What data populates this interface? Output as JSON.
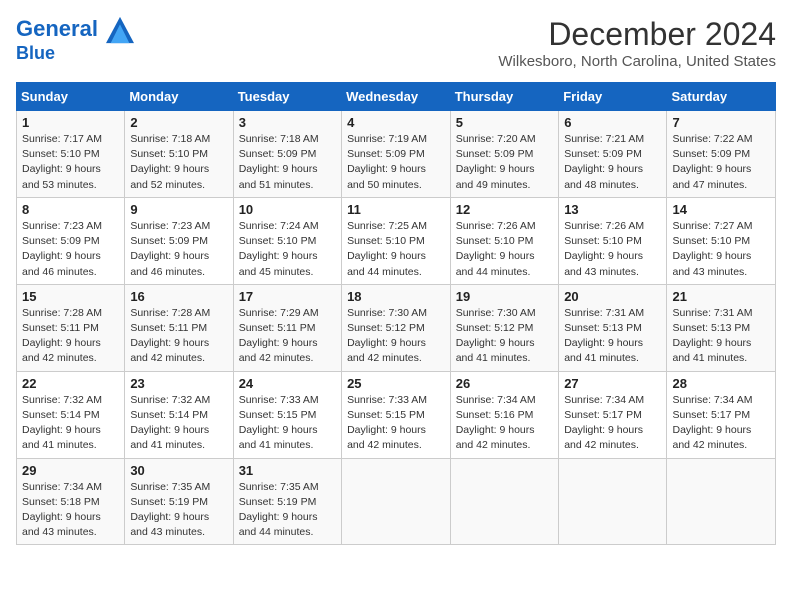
{
  "header": {
    "logo_line1": "General",
    "logo_line2": "Blue",
    "month_year": "December 2024",
    "location": "Wilkesboro, North Carolina, United States"
  },
  "weekdays": [
    "Sunday",
    "Monday",
    "Tuesday",
    "Wednesday",
    "Thursday",
    "Friday",
    "Saturday"
  ],
  "weeks": [
    [
      {
        "day": "1",
        "info": "Sunrise: 7:17 AM\nSunset: 5:10 PM\nDaylight: 9 hours\nand 53 minutes."
      },
      {
        "day": "2",
        "info": "Sunrise: 7:18 AM\nSunset: 5:10 PM\nDaylight: 9 hours\nand 52 minutes."
      },
      {
        "day": "3",
        "info": "Sunrise: 7:18 AM\nSunset: 5:09 PM\nDaylight: 9 hours\nand 51 minutes."
      },
      {
        "day": "4",
        "info": "Sunrise: 7:19 AM\nSunset: 5:09 PM\nDaylight: 9 hours\nand 50 minutes."
      },
      {
        "day": "5",
        "info": "Sunrise: 7:20 AM\nSunset: 5:09 PM\nDaylight: 9 hours\nand 49 minutes."
      },
      {
        "day": "6",
        "info": "Sunrise: 7:21 AM\nSunset: 5:09 PM\nDaylight: 9 hours\nand 48 minutes."
      },
      {
        "day": "7",
        "info": "Sunrise: 7:22 AM\nSunset: 5:09 PM\nDaylight: 9 hours\nand 47 minutes."
      }
    ],
    [
      {
        "day": "8",
        "info": "Sunrise: 7:23 AM\nSunset: 5:09 PM\nDaylight: 9 hours\nand 46 minutes."
      },
      {
        "day": "9",
        "info": "Sunrise: 7:23 AM\nSunset: 5:09 PM\nDaylight: 9 hours\nand 46 minutes."
      },
      {
        "day": "10",
        "info": "Sunrise: 7:24 AM\nSunset: 5:10 PM\nDaylight: 9 hours\nand 45 minutes."
      },
      {
        "day": "11",
        "info": "Sunrise: 7:25 AM\nSunset: 5:10 PM\nDaylight: 9 hours\nand 44 minutes."
      },
      {
        "day": "12",
        "info": "Sunrise: 7:26 AM\nSunset: 5:10 PM\nDaylight: 9 hours\nand 44 minutes."
      },
      {
        "day": "13",
        "info": "Sunrise: 7:26 AM\nSunset: 5:10 PM\nDaylight: 9 hours\nand 43 minutes."
      },
      {
        "day": "14",
        "info": "Sunrise: 7:27 AM\nSunset: 5:10 PM\nDaylight: 9 hours\nand 43 minutes."
      }
    ],
    [
      {
        "day": "15",
        "info": "Sunrise: 7:28 AM\nSunset: 5:11 PM\nDaylight: 9 hours\nand 42 minutes."
      },
      {
        "day": "16",
        "info": "Sunrise: 7:28 AM\nSunset: 5:11 PM\nDaylight: 9 hours\nand 42 minutes."
      },
      {
        "day": "17",
        "info": "Sunrise: 7:29 AM\nSunset: 5:11 PM\nDaylight: 9 hours\nand 42 minutes."
      },
      {
        "day": "18",
        "info": "Sunrise: 7:30 AM\nSunset: 5:12 PM\nDaylight: 9 hours\nand 42 minutes."
      },
      {
        "day": "19",
        "info": "Sunrise: 7:30 AM\nSunset: 5:12 PM\nDaylight: 9 hours\nand 41 minutes."
      },
      {
        "day": "20",
        "info": "Sunrise: 7:31 AM\nSunset: 5:13 PM\nDaylight: 9 hours\nand 41 minutes."
      },
      {
        "day": "21",
        "info": "Sunrise: 7:31 AM\nSunset: 5:13 PM\nDaylight: 9 hours\nand 41 minutes."
      }
    ],
    [
      {
        "day": "22",
        "info": "Sunrise: 7:32 AM\nSunset: 5:14 PM\nDaylight: 9 hours\nand 41 minutes."
      },
      {
        "day": "23",
        "info": "Sunrise: 7:32 AM\nSunset: 5:14 PM\nDaylight: 9 hours\nand 41 minutes."
      },
      {
        "day": "24",
        "info": "Sunrise: 7:33 AM\nSunset: 5:15 PM\nDaylight: 9 hours\nand 41 minutes."
      },
      {
        "day": "25",
        "info": "Sunrise: 7:33 AM\nSunset: 5:15 PM\nDaylight: 9 hours\nand 42 minutes."
      },
      {
        "day": "26",
        "info": "Sunrise: 7:34 AM\nSunset: 5:16 PM\nDaylight: 9 hours\nand 42 minutes."
      },
      {
        "day": "27",
        "info": "Sunrise: 7:34 AM\nSunset: 5:17 PM\nDaylight: 9 hours\nand 42 minutes."
      },
      {
        "day": "28",
        "info": "Sunrise: 7:34 AM\nSunset: 5:17 PM\nDaylight: 9 hours\nand 42 minutes."
      }
    ],
    [
      {
        "day": "29",
        "info": "Sunrise: 7:34 AM\nSunset: 5:18 PM\nDaylight: 9 hours\nand 43 minutes."
      },
      {
        "day": "30",
        "info": "Sunrise: 7:35 AM\nSunset: 5:19 PM\nDaylight: 9 hours\nand 43 minutes."
      },
      {
        "day": "31",
        "info": "Sunrise: 7:35 AM\nSunset: 5:19 PM\nDaylight: 9 hours\nand 44 minutes."
      },
      {
        "day": "",
        "info": ""
      },
      {
        "day": "",
        "info": ""
      },
      {
        "day": "",
        "info": ""
      },
      {
        "day": "",
        "info": ""
      }
    ]
  ]
}
